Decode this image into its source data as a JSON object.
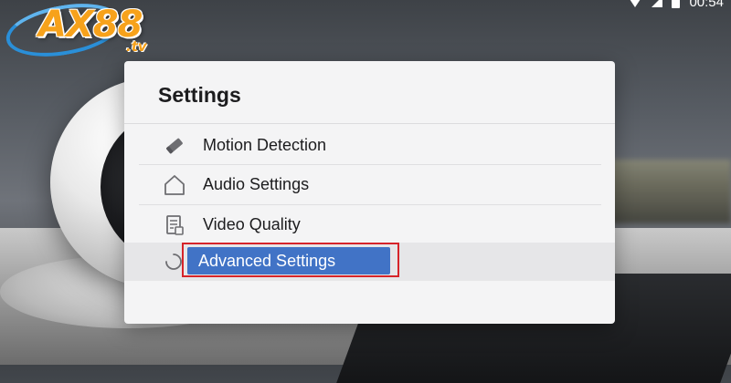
{
  "logo": {
    "text": "AX88",
    "suffix": ".tv"
  },
  "status_bar": {
    "time": "00:54"
  },
  "dialog": {
    "title": "Settings",
    "items": [
      {
        "label": "Motion Detection",
        "icon": "pencil-icon"
      },
      {
        "label": "Audio Settings",
        "icon": "home-icon"
      },
      {
        "label": "Video Quality",
        "icon": "document-icon"
      },
      {
        "label": "Advanced Settings",
        "icon": "loading-spinner-icon",
        "selected": true
      }
    ]
  },
  "colors": {
    "selection": "#4173c6",
    "focus_outline": "#d6242a",
    "logo": "#f7a21b",
    "logo_swoosh": "#2a8fd8"
  }
}
